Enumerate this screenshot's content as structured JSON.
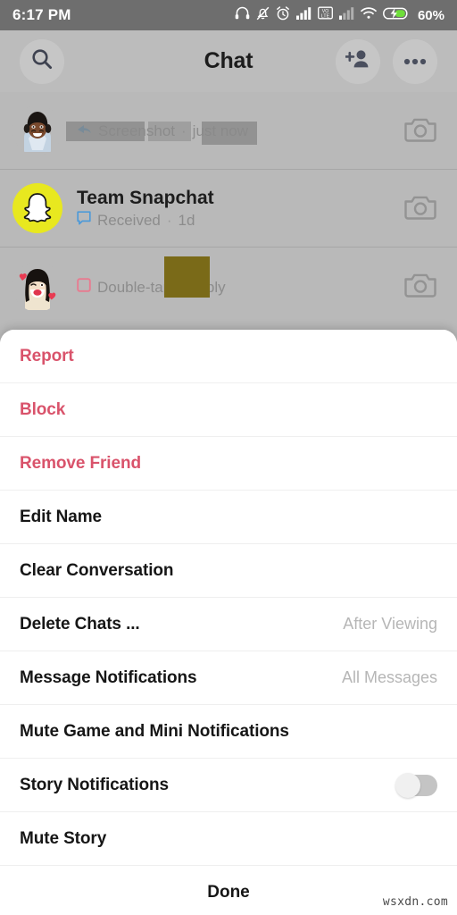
{
  "status_bar": {
    "time": "6:17 PM",
    "battery_percent": "60%",
    "icons": [
      "headphones-icon",
      "bell-muted-icon",
      "alarm-clock-icon",
      "signal-bars-icon",
      "volte-icon",
      "signal-bars-secondary-icon",
      "wifi-icon",
      "battery-charging-icon"
    ]
  },
  "header": {
    "title": "Chat",
    "search_icon": "search-icon",
    "add_friend_icon": "add-friend-icon",
    "more_icon": "more-options-icon"
  },
  "chat_list": [
    {
      "name": "",
      "name_redacted": true,
      "status": "Screenshot",
      "separator": "·",
      "time": "just now",
      "status_icon": "screenshot-arrow-icon",
      "avatar": "bitmoji-male-headphones",
      "camera_icon": "camera-icon"
    },
    {
      "name": "Team Snapchat",
      "name_redacted": false,
      "status": "Received",
      "separator": "·",
      "time": "1d",
      "status_icon": "chat-bubble-icon",
      "avatar": "snapchat-ghost",
      "camera_icon": "camera-icon"
    },
    {
      "name": "",
      "name_redacted": true,
      "status": "Double-tap to reply",
      "separator": "",
      "time": "",
      "status_icon": "snap-square-icon",
      "avatar": "bitmoji-female-mask",
      "camera_icon": "camera-icon"
    }
  ],
  "action_sheet": {
    "items": [
      {
        "label": "Report",
        "value": "",
        "style": "danger",
        "control": "none"
      },
      {
        "label": "Block",
        "value": "",
        "style": "danger",
        "control": "none"
      },
      {
        "label": "Remove Friend",
        "value": "",
        "style": "danger",
        "control": "none"
      },
      {
        "label": "Edit Name",
        "value": "",
        "style": "normal",
        "control": "none"
      },
      {
        "label": "Clear Conversation",
        "value": "",
        "style": "normal",
        "control": "none"
      },
      {
        "label": "Delete Chats ...",
        "value": "After Viewing",
        "style": "normal",
        "control": "value"
      },
      {
        "label": "Message Notifications",
        "value": "All Messages",
        "style": "normal",
        "control": "value"
      },
      {
        "label": "Mute Game and Mini Notifications",
        "value": "",
        "style": "normal",
        "control": "none"
      },
      {
        "label": "Story Notifications",
        "value": "",
        "style": "normal",
        "control": "toggle",
        "toggle_on": false
      },
      {
        "label": "Mute Story",
        "value": "",
        "style": "normal",
        "control": "none"
      }
    ],
    "done_label": "Done"
  },
  "watermark": "wsxdn.com",
  "colors": {
    "danger": "#d9536b",
    "sheet_bg": "#ffffff",
    "app_bg": "#b9b9b9",
    "statusbar_bg": "#6e6e6e",
    "snapchat_yellow": "#e8e81f",
    "muted_text": "#8c8c8c"
  }
}
